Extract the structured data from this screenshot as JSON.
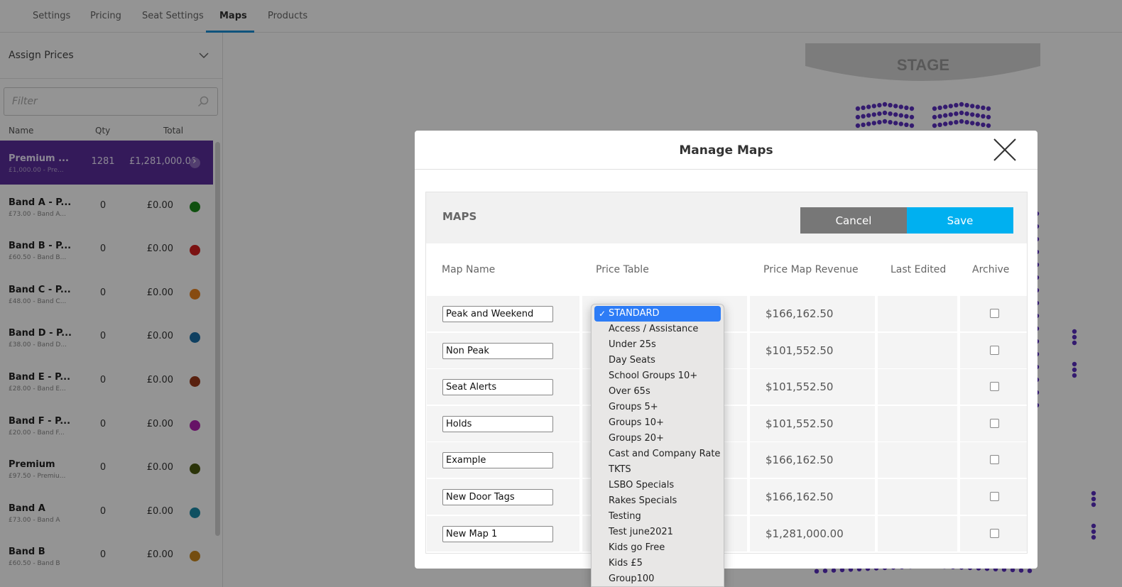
{
  "tabs": [
    {
      "label": "Settings",
      "active": false
    },
    {
      "label": "Pricing",
      "active": false
    },
    {
      "label": "Seat Settings",
      "active": false
    },
    {
      "label": "Maps",
      "active": true
    },
    {
      "label": "Products",
      "active": false
    }
  ],
  "sidebar": {
    "section_title": "Assign Prices",
    "filter_placeholder": "Filter",
    "columns": {
      "name": "Name",
      "qty": "Qty",
      "total": "Total"
    },
    "bands": [
      {
        "name": "Premium ...",
        "sub": "£1,000.00 - Pre...",
        "qty": "1281",
        "total": "£1,281,000.00",
        "color": "#8e6bbf",
        "selected": true
      },
      {
        "name": "Band A - P...",
        "sub": "£73.00 - Band A...",
        "qty": "0",
        "total": "£0.00",
        "color": "#1a8a1a",
        "selected": false
      },
      {
        "name": "Band B - P...",
        "sub": "£60.50 - Band B...",
        "qty": "0",
        "total": "£0.00",
        "color": "#d42020",
        "selected": false
      },
      {
        "name": "Band C - P...",
        "sub": "£48.00 - Band C...",
        "qty": "0",
        "total": "£0.00",
        "color": "#e8821e",
        "selected": false
      },
      {
        "name": "Band D - P...",
        "sub": "£38.00 - Band D...",
        "qty": "0",
        "total": "£0.00",
        "color": "#1a6fa8",
        "selected": false
      },
      {
        "name": "Band E - P...",
        "sub": "£28.00 - Band E...",
        "qty": "0",
        "total": "£0.00",
        "color": "#9a3a1a",
        "selected": false
      },
      {
        "name": "Band F - P...",
        "sub": "£20.00 - Band F...",
        "qty": "0",
        "total": "£0.00",
        "color": "#b020b0",
        "selected": false
      },
      {
        "name": "Premium",
        "sub": "£97.50 - Premiu...",
        "qty": "0",
        "total": "£0.00",
        "color": "#4a5a10",
        "selected": false
      },
      {
        "name": "Band A",
        "sub": "£73.00 - Band A",
        "qty": "0",
        "total": "£0.00",
        "color": "#1a8aa8",
        "selected": false
      },
      {
        "name": "Band B",
        "sub": "£60.50 - Band B",
        "qty": "0",
        "total": "£0.00",
        "color": "#c8861a",
        "selected": false
      }
    ]
  },
  "seatmap": {
    "stage_label": "STAGE",
    "seat_color": "#5a2fc0"
  },
  "modal": {
    "title": "Manage Maps",
    "panel_title": "MAPS",
    "cancel_label": "Cancel",
    "save_label": "Save",
    "columns": [
      "Map Name",
      "Price Table",
      "Price Map Revenue",
      "Last Edited",
      "Archive"
    ],
    "rows": [
      {
        "name": "Peak and Weekend",
        "revenue": "$166,162.50",
        "last_edited": ""
      },
      {
        "name": "Non Peak",
        "revenue": "$101,552.50",
        "last_edited": ""
      },
      {
        "name": "Seat Alerts",
        "revenue": "$101,552.50",
        "last_edited": ""
      },
      {
        "name": "Holds",
        "revenue": "$101,552.50",
        "last_edited": ""
      },
      {
        "name": "Example",
        "revenue": "$166,162.50",
        "last_edited": ""
      },
      {
        "name": "New Door Tags",
        "revenue": "$166,162.50",
        "last_edited": ""
      },
      {
        "name": "New Map 1",
        "revenue": "$1,281,000.00",
        "last_edited": ""
      }
    ]
  },
  "dropdown": {
    "selected": "STANDARD",
    "options": [
      "STANDARD",
      "Access / Assistance",
      "Under 25s",
      "Day Seats",
      "School Groups 10+",
      "Over 65s",
      "Groups 5+",
      "Groups 10+",
      "Groups 20+",
      "Cast and Company Rate",
      "TKTS",
      "LSBO Specials",
      "Rakes Specials",
      "Testing",
      "Test june2021",
      "Kids go Free",
      "Kids £5",
      "Group100"
    ]
  }
}
